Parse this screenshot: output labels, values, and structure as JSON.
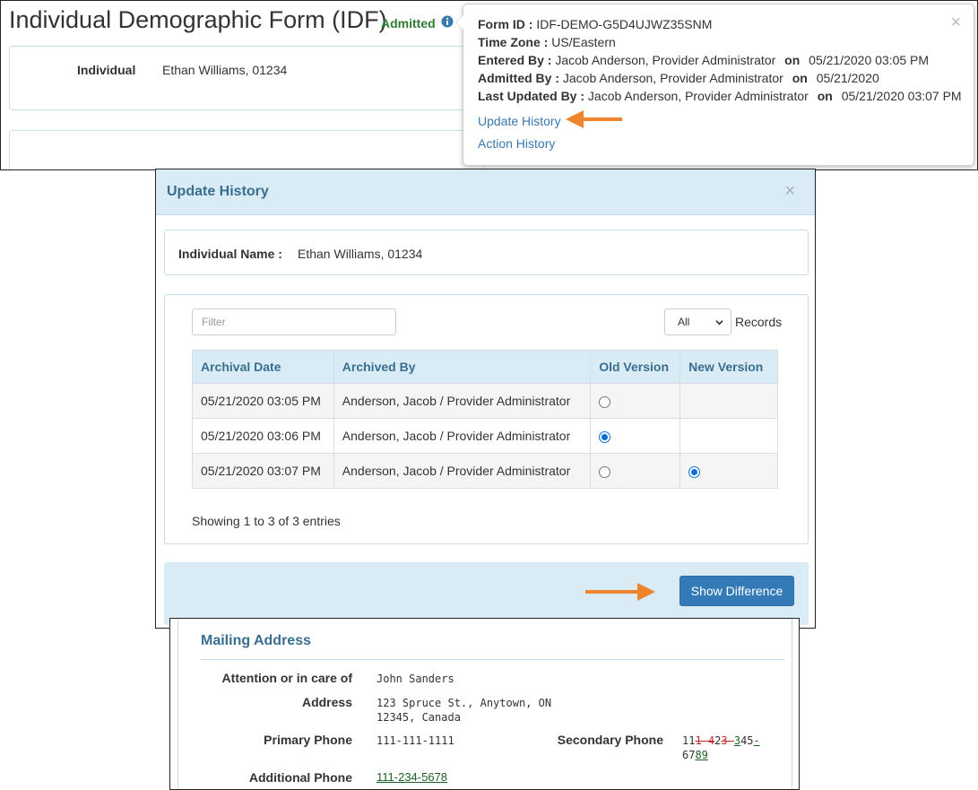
{
  "form": {
    "title": "Individual Demographic Form (IDF)",
    "status": "Admitted",
    "individual_label": "Individual",
    "individual_value": "Ethan Williams, 01234"
  },
  "popover": {
    "form_id_label": "Form ID :",
    "form_id": "IDF-DEMO-G5D4UJWZ35SNM",
    "time_zone_label": "Time Zone :",
    "time_zone": "US/Eastern",
    "entered_by_label": "Entered By :",
    "entered_by": "Jacob Anderson, Provider Administrator",
    "entered_on": "05/21/2020 03:05 PM",
    "admitted_by_label": "Admitted By :",
    "admitted_by": "Jacob Anderson, Provider Administrator",
    "admitted_on": "05/21/2020",
    "last_updated_label": "Last Updated By :",
    "last_updated_by": "Jacob Anderson, Provider Administrator",
    "last_updated_on": "05/21/2020 03:07 PM",
    "on_word": "on",
    "close": "×",
    "update_history_link": "Update History",
    "action_history_link": "Action History"
  },
  "modal": {
    "title": "Update History",
    "close": "×",
    "individual_name_label": "Individual Name :",
    "individual_name": "Ethan Williams, 01234",
    "filter_placeholder": "Filter",
    "length_value": "All",
    "records_label": "Records",
    "columns": [
      "Archival Date",
      "Archived By",
      "Old Version",
      "New Version"
    ],
    "rows": [
      {
        "date": "05/21/2020 03:05 PM",
        "by": "Anderson, Jacob / Provider Administrator",
        "old": "unchecked",
        "new": ""
      },
      {
        "date": "05/21/2020 03:06 PM",
        "by": "Anderson, Jacob / Provider Administrator",
        "old": "checked",
        "new": ""
      },
      {
        "date": "05/21/2020 03:07 PM",
        "by": "Anderson, Jacob / Provider Administrator",
        "old": "unchecked",
        "new": "checked"
      }
    ],
    "showing": "Showing 1 to 3 of 3 entries",
    "show_difference": "Show Difference"
  },
  "mailing": {
    "title": "Mailing Address",
    "attention_label": "Attention or in care of",
    "attention": "John Sanders",
    "address_label": "Address",
    "address_line1": "123 Spruce St., Anytown, ON",
    "address_line2": "12345, Canada",
    "primary_phone_label": "Primary Phone",
    "primary_phone": "111-111-1111",
    "secondary_phone_label": "Secondary Phone",
    "secondary_phone_parts": {
      "p1": "11",
      "r1": "1-4",
      "a1": "",
      "p2": "2",
      "r2": "3-",
      "a2": "3",
      "p3": "45",
      "a3": "-",
      "p4": "67",
      "a4": "89"
    },
    "additional_phone_label": "Additional Phone",
    "additional_phone": "111-234-5678"
  },
  "colors": {
    "accent_blue": "#337ab7",
    "header_bg": "#d9ecf6",
    "arrow_orange": "#f0842d",
    "admitted_green": "#2e7d32"
  }
}
